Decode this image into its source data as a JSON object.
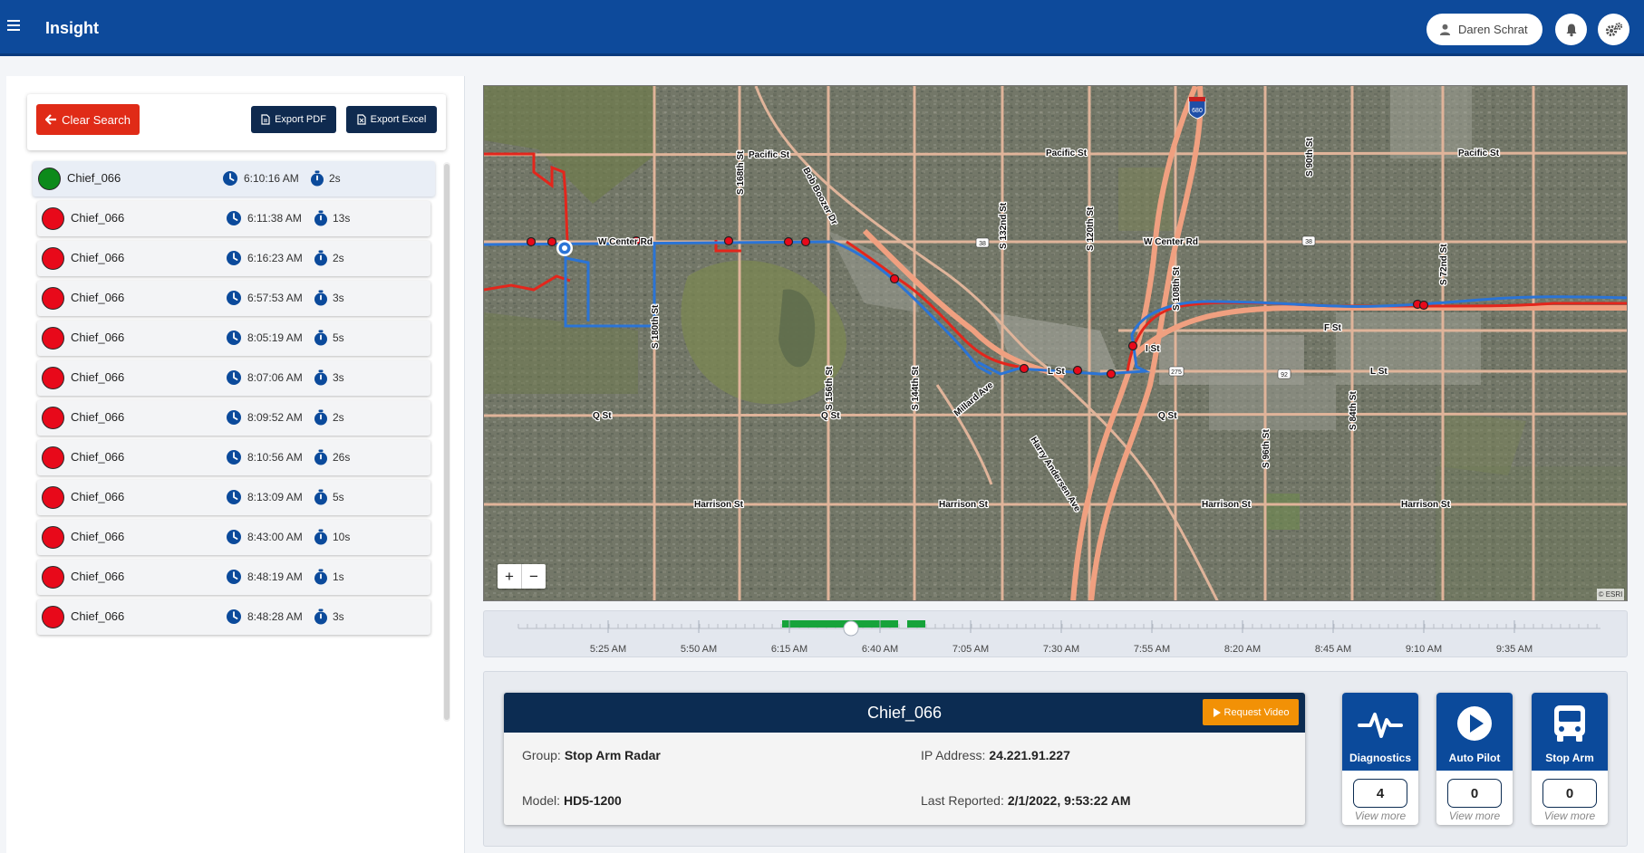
{
  "header": {
    "title": "Insight",
    "user_name": "Daren Schrat"
  },
  "search": {
    "clear_label": "Clear Search",
    "export_pdf_label": "Export PDF",
    "export_excel_label": "Export Excel"
  },
  "events": [
    {
      "name": "Chief_066",
      "time": "6:10:16 AM",
      "duration": "2s",
      "status": "green"
    },
    {
      "name": "Chief_066",
      "time": "6:11:38 AM",
      "duration": "13s",
      "status": "red"
    },
    {
      "name": "Chief_066",
      "time": "6:16:23 AM",
      "duration": "2s",
      "status": "red"
    },
    {
      "name": "Chief_066",
      "time": "6:57:53 AM",
      "duration": "3s",
      "status": "red"
    },
    {
      "name": "Chief_066",
      "time": "8:05:19 AM",
      "duration": "5s",
      "status": "red"
    },
    {
      "name": "Chief_066",
      "time": "8:07:06 AM",
      "duration": "3s",
      "status": "red"
    },
    {
      "name": "Chief_066",
      "time": "8:09:52 AM",
      "duration": "2s",
      "status": "red"
    },
    {
      "name": "Chief_066",
      "time": "8:10:56 AM",
      "duration": "26s",
      "status": "red"
    },
    {
      "name": "Chief_066",
      "time": "8:13:09 AM",
      "duration": "5s",
      "status": "red"
    },
    {
      "name": "Chief_066",
      "time": "8:43:00 AM",
      "duration": "10s",
      "status": "red"
    },
    {
      "name": "Chief_066",
      "time": "8:48:19 AM",
      "duration": "1s",
      "status": "red"
    },
    {
      "name": "Chief_066",
      "time": "8:48:28 AM",
      "duration": "3s",
      "status": "red"
    }
  ],
  "map": {
    "attribution": "© ESRI",
    "zoom_in": "+",
    "zoom_out": "−",
    "labels": {
      "pacific_st_w": "Pacific St",
      "pacific_st_c": "Pacific St",
      "pacific_st_e": "Pacific St",
      "w_center_w": "W Center Rd",
      "w_center_e": "W Center Rd",
      "f_st": "F St",
      "i_st": "I St",
      "l_st_c": "L St",
      "l_st_e": "L St",
      "q_st_w": "Q St",
      "q_st_c": "Q St",
      "q_st_e": "Q St",
      "harrison_1": "Harrison St",
      "harrison_2": "Harrison St",
      "harrison_3": "Harrison St",
      "harrison_4": "Harrison St",
      "millard_ave": "Millard Ave",
      "harry_andersen": "Harry Andersen Ave",
      "bob_boozer": "Bob Boozer Dr",
      "s180": "S 180th St",
      "s168": "S 168th St",
      "s156": "S 156th St",
      "s144": "S 144th St",
      "s132": "S 132nd St",
      "s120": "S 120th St",
      "s108": "S 108th St",
      "s96": "S 96th St",
      "s90": "S 90th St",
      "s84": "S 84th St",
      "s72": "S 72nd St",
      "i680": "680",
      "hwy38_a": "38",
      "hwy38_b": "38",
      "hwy275": "275",
      "hwy92": "92"
    }
  },
  "timeline": {
    "ticks": [
      "5:25 AM",
      "5:50 AM",
      "6:15 AM",
      "6:40 AM",
      "7:05 AM",
      "7:30 AM",
      "7:55 AM",
      "8:20 AM",
      "8:45 AM",
      "9:10 AM",
      "9:35 AM"
    ]
  },
  "vehicle": {
    "name": "Chief_066",
    "request_video_label": "Request Video",
    "group_key": "Group:",
    "group": "Stop Arm Radar",
    "model_key": "Model:",
    "model": "HD5-1200",
    "ip_key": "IP Address:",
    "ip": "24.221.91.227",
    "reported_key": "Last Reported:",
    "last_reported": "2/1/2022, 9:53:22 AM"
  },
  "stats": [
    {
      "label": "Diagnostics",
      "count": "4",
      "more": "View more"
    },
    {
      "label": "Auto Pilot",
      "count": "0",
      "more": "View more"
    },
    {
      "label": "Stop Arm",
      "count": "0",
      "more": "View more"
    }
  ],
  "colors": {
    "header_blue": "#0d4a9b",
    "dark_navy": "#0c2c52",
    "clear_red": "#e02b17",
    "video_orange": "#f29106",
    "route_blue": "#2b74d6",
    "route_red": "#e3261c",
    "status_green": "#0c8a1a",
    "status_red": "#e8091a",
    "timeline_green": "#16a33a"
  }
}
